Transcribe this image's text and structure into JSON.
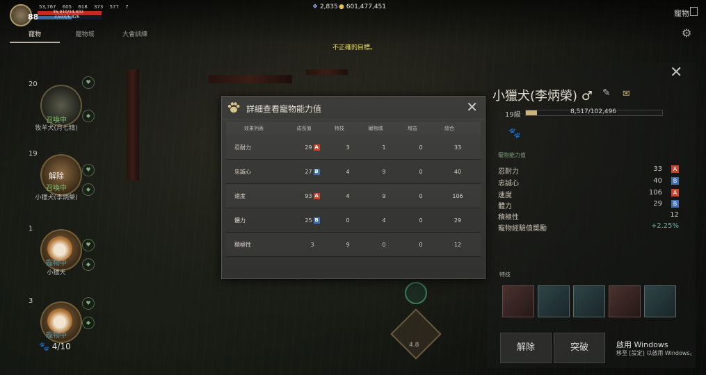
{
  "player": {
    "level": "88",
    "stats": [
      "53,767",
      "605",
      "618",
      "373",
      "577",
      "7"
    ],
    "hp": "35,910/34,402",
    "hp_fraction": 1.0,
    "mp": "3,634/6,826",
    "mp_fraction": 0.53
  },
  "currency": {
    "pearls": "2,835",
    "silver": "601,477,451"
  },
  "top_title": "寵物",
  "tabs": [
    "寵物",
    "寵物城",
    "大會訓練"
  ],
  "notice": "不正確的目標。",
  "pets": [
    {
      "num": "20",
      "status": "召喚中",
      "name": "牧羊犬(月七精)",
      "dismiss": ""
    },
    {
      "num": "19",
      "status": "召喚中",
      "name": "小獵犬(李炳榮)",
      "dismiss": "解除"
    },
    {
      "num": "1",
      "status": "寵物中",
      "name": "小獵犬",
      "dismiss": ""
    },
    {
      "num": "3",
      "status": "寵物中",
      "name": "",
      "dismiss": ""
    }
  ],
  "pet_count": "4/10",
  "right_panel": {
    "name": "小獵犬(李炳榮) ♂",
    "level": "19級",
    "exp": "8,517/102,496",
    "exp_fraction": 0.083,
    "subtitle": "寵物能力值",
    "stats": [
      {
        "label": "忍耐力",
        "value": "33",
        "grade": "A"
      },
      {
        "label": "忠誠心",
        "value": "40",
        "grade": "B"
      },
      {
        "label": "速度",
        "value": "106",
        "grade": "A"
      },
      {
        "label": "體力",
        "value": "29",
        "grade": "B"
      },
      {
        "label": "積極性",
        "value": "12",
        "grade": ""
      },
      {
        "label": "寵物經驗值獎勵",
        "value": "+2.25%",
        "grade": ""
      }
    ],
    "trait_label": "特技",
    "buttons": [
      "解除",
      "突破"
    ],
    "windows_activation": "啟用 Windows",
    "windows_activation_sub": "移至 [設定] 以啟用 Windows。"
  },
  "center_number": "4.8",
  "modal": {
    "title": "詳細查看寵物能力值",
    "headers": [
      "效果列表",
      "成長值",
      "特技",
      "寵物城",
      "增益",
      "總合"
    ],
    "rows": [
      {
        "label": "忍耐力",
        "growth": "29",
        "grade": "A",
        "skill": "3",
        "city": "1",
        "buff": "0",
        "total": "33"
      },
      {
        "label": "忠誠心",
        "growth": "27",
        "grade": "B",
        "skill": "4",
        "city": "9",
        "buff": "0",
        "total": "40"
      },
      {
        "label": "速度",
        "growth": "93",
        "grade": "A",
        "skill": "4",
        "city": "9",
        "buff": "0",
        "total": "106"
      },
      {
        "label": "體力",
        "growth": "25",
        "grade": "B",
        "skill": "0",
        "city": "4",
        "buff": "0",
        "total": "29"
      },
      {
        "label": "積極性",
        "growth": "3",
        "grade": "",
        "skill": "9",
        "city": "0",
        "buff": "0",
        "total": "12"
      }
    ]
  },
  "colors": {
    "grade_A": "#c0472e",
    "grade_B": "#3f6fb0",
    "accent_gold": "#f0e060"
  }
}
